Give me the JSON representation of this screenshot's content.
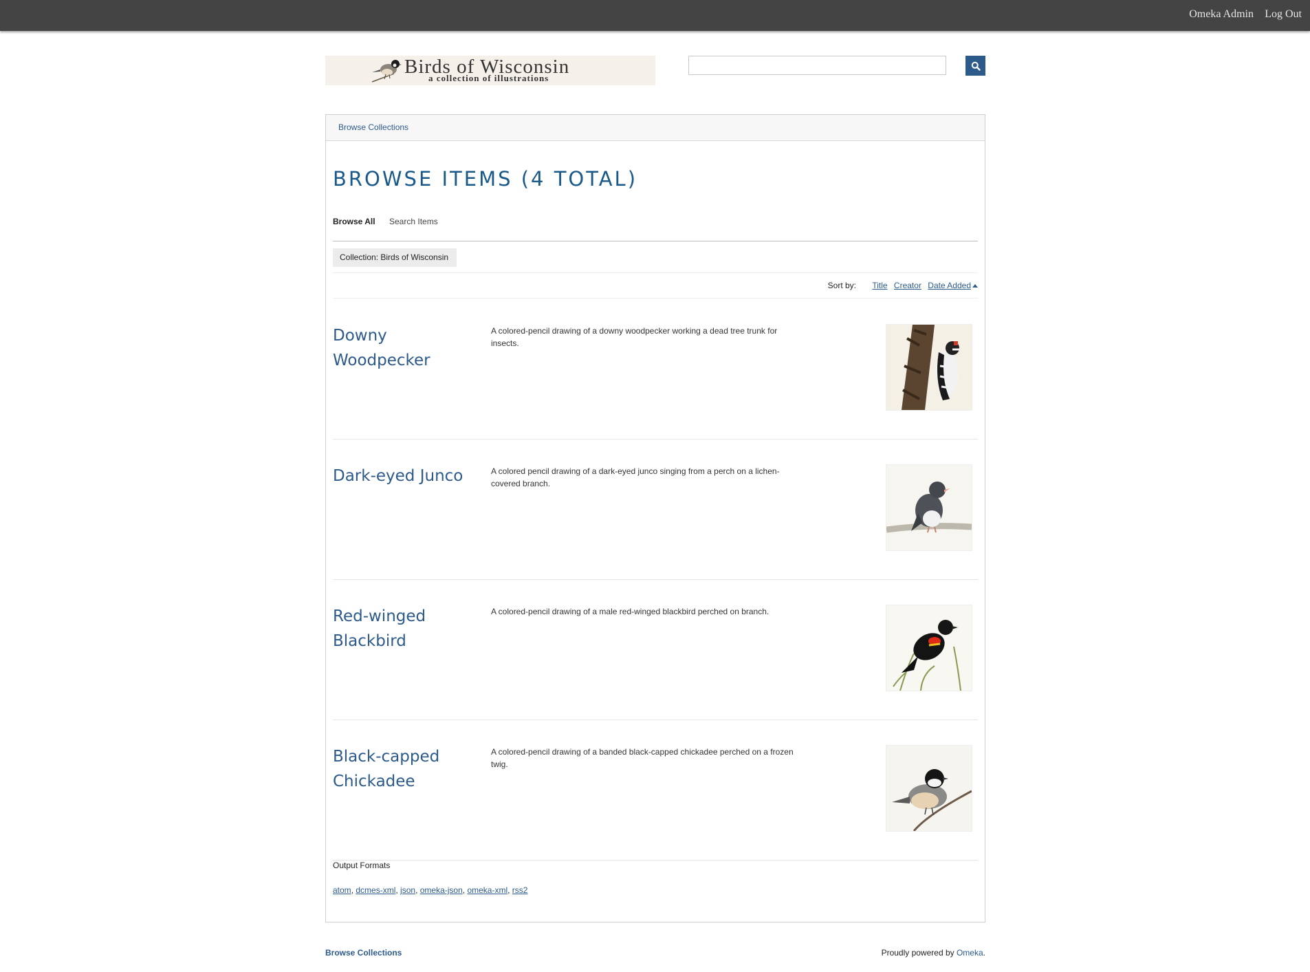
{
  "admin_bar": {
    "admin_link": "Omeka Admin",
    "logout_link": "Log Out"
  },
  "site": {
    "title": "Birds of Wisconsin",
    "subtitle": "a collection of illustrations"
  },
  "search": {
    "value": "",
    "placeholder": "",
    "button_icon": "search-icon"
  },
  "nav": {
    "browse_collections": "Browse Collections"
  },
  "page": {
    "title": "BROWSE ITEMS (4 TOTAL)",
    "subnav": {
      "browse_all": "Browse All",
      "search_items": "Search Items"
    },
    "filter": "Collection: Birds of Wisconsin",
    "sort": {
      "label": "Sort by:",
      "title": "Title",
      "creator": "Creator",
      "date_added": "Date Added",
      "date_added_icon": "caret-up-icon"
    }
  },
  "items": [
    {
      "title": "Downy Woodpecker",
      "description": "A colored-pencil drawing of a downy woodpecker working a dead tree trunk for insects."
    },
    {
      "title": "Dark-eyed Junco",
      "description": "A colored pencil drawing of a dark-eyed junco singing from a perch on a lichen-covered branch."
    },
    {
      "title": "Red-winged Blackbird",
      "description": "A colored-pencil drawing of a male red-winged blackbird perched on branch."
    },
    {
      "title": "Black-capped Chickadee",
      "description": "A colored-pencil drawing of a banded black-capped chickadee perched on a frozen twig."
    }
  ],
  "output": {
    "label": "Output Formats",
    "formats": [
      "atom",
      "dcmes-xml",
      "json",
      "omeka-json",
      "omeka-xml",
      "rss2"
    ]
  },
  "footer": {
    "browse_collections": "Browse Collections",
    "powered_by": "Proudly powered by",
    "omeka_link": "Omeka",
    "period": "."
  },
  "colors": {
    "topbar": "#444444",
    "link": "#2c5a8b",
    "title": "#1a5a8a",
    "search_button": "#2c5a8b"
  }
}
